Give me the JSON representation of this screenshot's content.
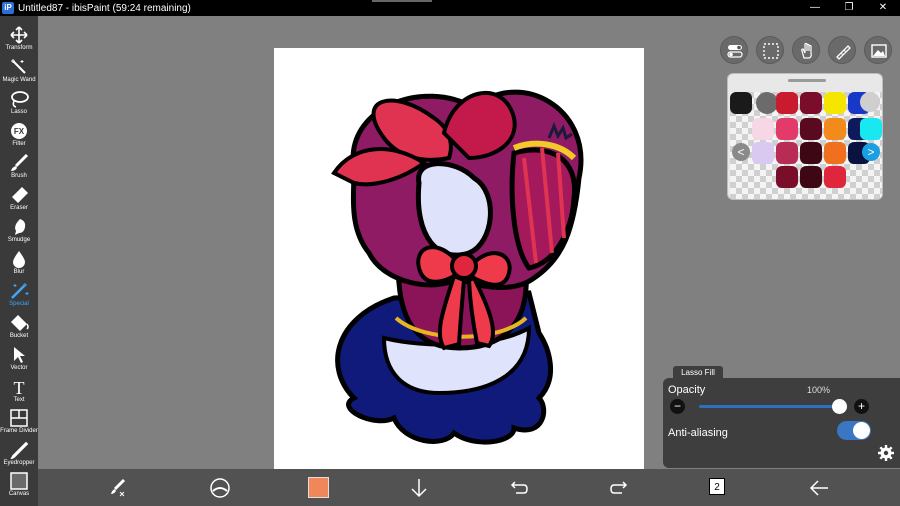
{
  "window": {
    "title": "Untitled87 - ibisPaint (59:24 remaining)",
    "app_icon": "iP",
    "controls": {
      "minimize": "—",
      "maximize": "❐",
      "close": "✕"
    }
  },
  "toolbar": {
    "items": [
      {
        "id": "transform",
        "label": "Transform",
        "icon": "transform-icon"
      },
      {
        "id": "magic-wand",
        "label": "Magic Wand",
        "icon": "magic-wand-icon"
      },
      {
        "id": "lasso",
        "label": "Lasso",
        "icon": "lasso-icon"
      },
      {
        "id": "filter",
        "label": "Filter",
        "icon": "filter-icon"
      },
      {
        "id": "brush",
        "label": "Brush",
        "icon": "brush-icon"
      },
      {
        "id": "eraser",
        "label": "Eraser",
        "icon": "eraser-icon"
      },
      {
        "id": "smudge",
        "label": "Smudge",
        "icon": "smudge-icon"
      },
      {
        "id": "blur",
        "label": "Blur",
        "icon": "blur-icon"
      },
      {
        "id": "special",
        "label": "Special",
        "icon": "special-icon",
        "active": true
      },
      {
        "id": "bucket",
        "label": "Bucket",
        "icon": "bucket-icon"
      },
      {
        "id": "vector",
        "label": "Vector",
        "icon": "vector-icon"
      },
      {
        "id": "text",
        "label": "Text",
        "icon": "text-icon"
      },
      {
        "id": "frame-divider",
        "label": "Frame Divider",
        "icon": "frame-divider-icon"
      },
      {
        "id": "eyedropper",
        "label": "Eyedropper",
        "icon": "eyedropper-icon"
      },
      {
        "id": "canvas",
        "label": "Canvas",
        "icon": "canvas-icon"
      }
    ],
    "filter_glyph": "FX",
    "text_glyph": "T",
    "active_color": "#3ea8ff"
  },
  "top_buttons": [
    {
      "id": "toggle-ui",
      "icon": "toggle-icon"
    },
    {
      "id": "selection",
      "icon": "selection-icon"
    },
    {
      "id": "hand",
      "icon": "hand-icon"
    },
    {
      "id": "ruler",
      "icon": "ruler-icon"
    },
    {
      "id": "reference",
      "icon": "image-icon"
    }
  ],
  "palette": {
    "nav_prev": "<",
    "nav_next": ">",
    "swatches": [
      "#1a1a1a",
      "#6b6b6b",
      "#c81b2e",
      "#7a0e2a",
      "#f5e600",
      "#1838c7",
      "#cfcfcf",
      "#f7d7e6",
      "#e23b6a",
      "#5a0a1e",
      "#f28a1c",
      "#0e1a5c",
      "#19e8f0",
      "#d9c8f0",
      "#b82b55",
      "#3d0713",
      "#f07020",
      "#0a1240",
      "#1c9fe0"
    ]
  },
  "lasso_fill": {
    "tab": "Lasso Fill",
    "opacity_label": "Opacity",
    "opacity_value": "100%",
    "opacity": 1.0,
    "minus": "−",
    "plus": "+",
    "antialias_label": "Anti-aliasing",
    "antialias_on": true
  },
  "bottom_bar": {
    "current_color": "#f0875a",
    "layer_count": "2"
  },
  "colors": {
    "toolbar_bg": "#3a3a3a",
    "workspace_bg": "#808080",
    "bottombar_bg": "#525252",
    "accent": "#3a76c4"
  }
}
